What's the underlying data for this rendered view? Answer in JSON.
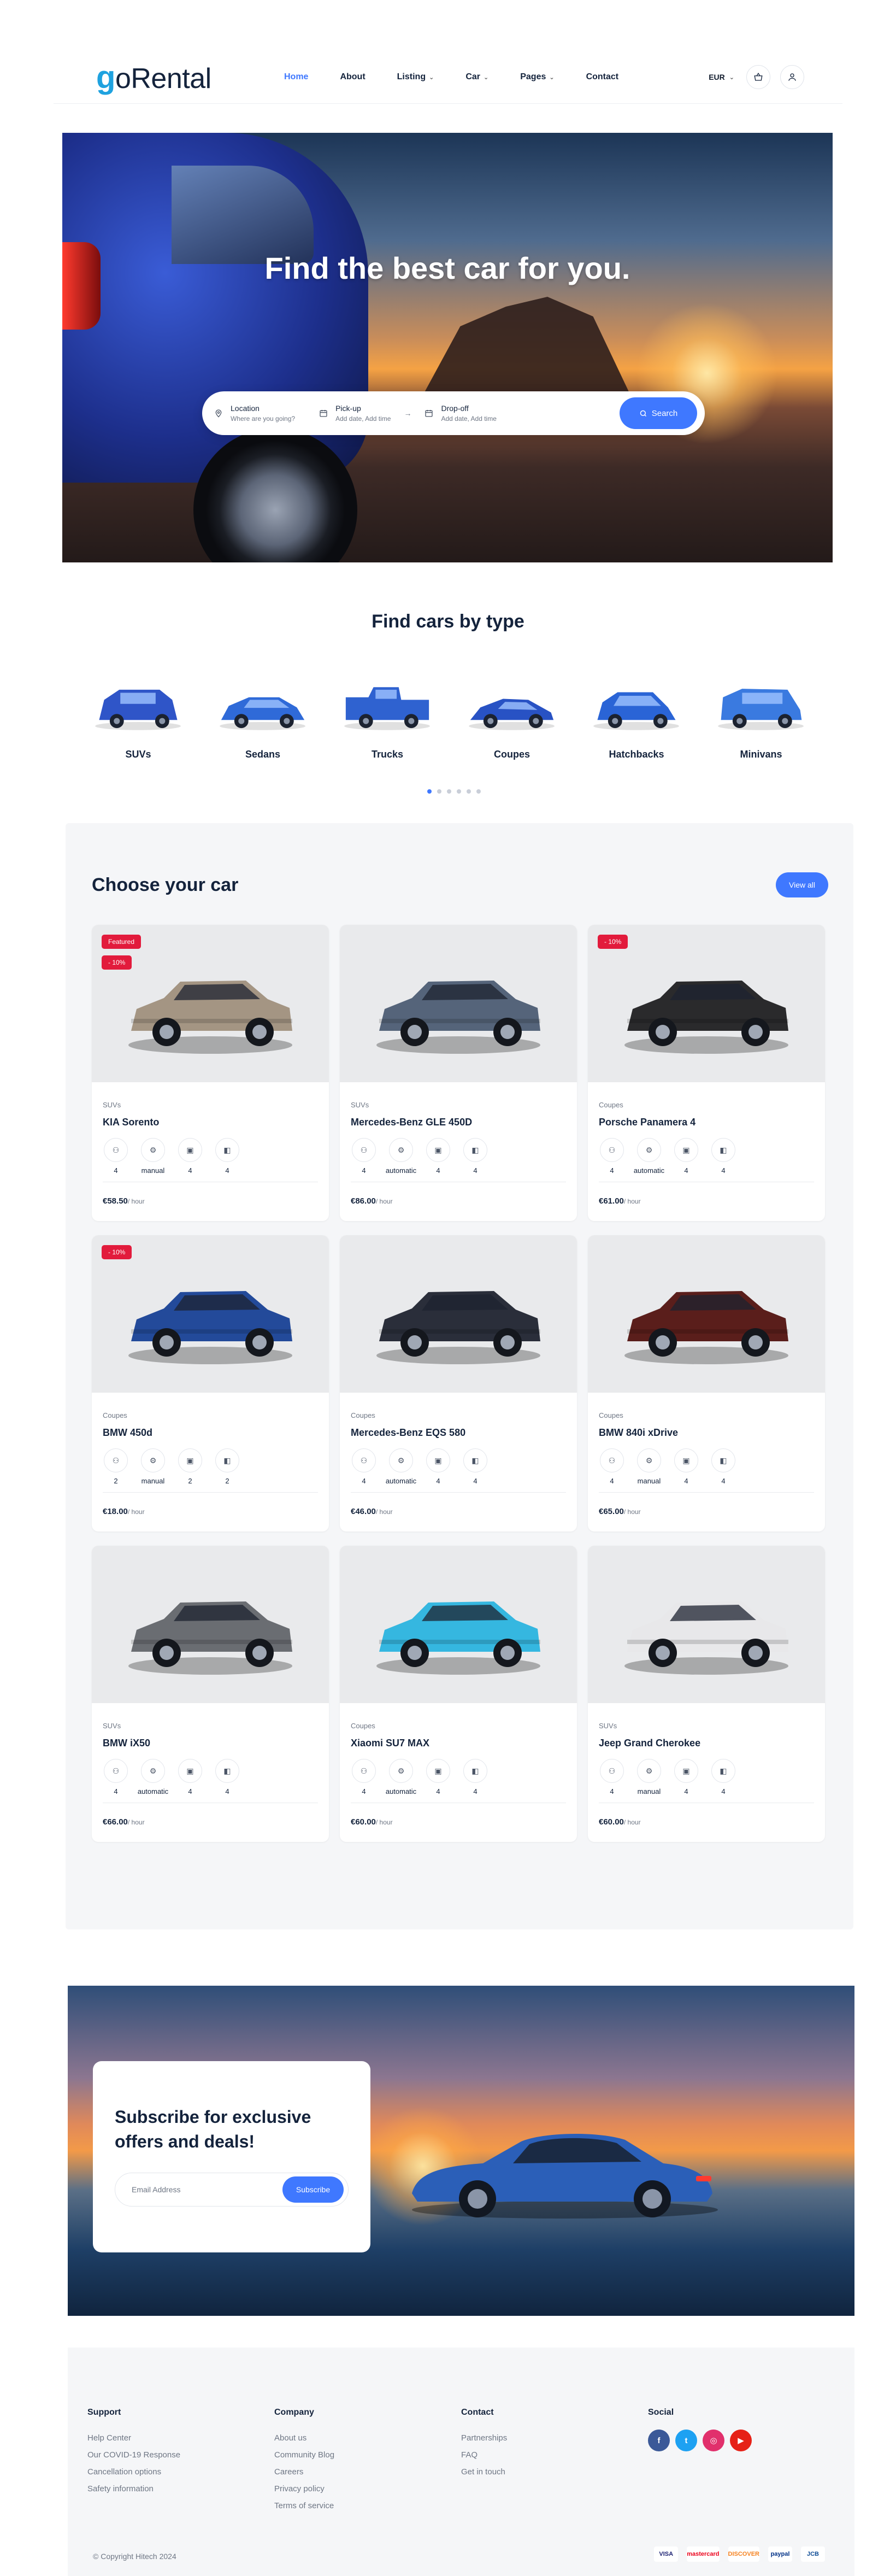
{
  "header": {
    "logo_g": "g",
    "logo_rest": "oRental",
    "nav": [
      {
        "label": "Home",
        "active": true,
        "dropdown": false
      },
      {
        "label": "About",
        "active": false,
        "dropdown": false
      },
      {
        "label": "Listing",
        "active": false,
        "dropdown": true
      },
      {
        "label": "Car",
        "active": false,
        "dropdown": true
      },
      {
        "label": "Pages",
        "active": false,
        "dropdown": true
      },
      {
        "label": "Contact",
        "active": false,
        "dropdown": false
      }
    ],
    "currency": "EUR"
  },
  "hero": {
    "title": "Find the best car for you.",
    "search": {
      "location_label": "Location",
      "location_placeholder": "Where are you going?",
      "pickup_label": "Pick-up",
      "pickup_placeholder": "Add date, Add time",
      "dropoff_label": "Drop-off",
      "dropoff_placeholder": "Add date, Add time",
      "button": "Search"
    }
  },
  "types": {
    "title": "Find cars by type",
    "items": [
      "SUVs",
      "Sedans",
      "Trucks",
      "Coupes",
      "Hatchbacks",
      "Minivans"
    ],
    "pagination": {
      "total": 6,
      "active": 0
    }
  },
  "listing": {
    "title": "Choose your car",
    "view_all": "View all",
    "per_unit": "/ hour",
    "cars": [
      {
        "category": "SUVs",
        "name": "KIA Sorento",
        "badges": [
          "Featured",
          "- 10%"
        ],
        "seats": "4",
        "transmission": "manual",
        "bags": "4",
        "doors": "4",
        "price": "€58.50",
        "color": "#a49583"
      },
      {
        "category": "SUVs",
        "name": "Mercedes-Benz GLE 450D",
        "badges": [],
        "seats": "4",
        "transmission": "automatic",
        "bags": "4",
        "doors": "4",
        "price": "€86.00",
        "color": "#55647a"
      },
      {
        "category": "Coupes",
        "name": "Porsche Panamera 4",
        "badges": [
          "- 10%"
        ],
        "seats": "4",
        "transmission": "automatic",
        "bags": "4",
        "doors": "4",
        "price": "€61.00",
        "color": "#2a2a2c"
      },
      {
        "category": "Coupes",
        "name": "BMW 450d",
        "badges": [
          "- 10%"
        ],
        "seats": "2",
        "transmission": "manual",
        "bags": "2",
        "doors": "2",
        "price": "€18.00",
        "color": "#234a9a"
      },
      {
        "category": "Coupes",
        "name": "Mercedes-Benz EQS 580",
        "badges": [],
        "seats": "4",
        "transmission": "automatic",
        "bags": "4",
        "doors": "4",
        "price": "€46.00",
        "color": "#2a2e3a"
      },
      {
        "category": "Coupes",
        "name": "BMW 840i xDrive",
        "badges": [],
        "seats": "4",
        "transmission": "manual",
        "bags": "4",
        "doors": "4",
        "price": "€65.00",
        "color": "#5a1e1b"
      },
      {
        "category": "SUVs",
        "name": "BMW iX50",
        "badges": [],
        "seats": "4",
        "transmission": "automatic",
        "bags": "4",
        "doors": "4",
        "price": "€66.00",
        "color": "#6a6d72"
      },
      {
        "category": "Coupes",
        "name": "Xiaomi SU7 MAX",
        "badges": [],
        "seats": "4",
        "transmission": "automatic",
        "bags": "4",
        "doors": "4",
        "price": "€60.00",
        "color": "#35b7e0"
      },
      {
        "category": "SUVs",
        "name": "Jeep Grand Cherokee",
        "badges": [],
        "seats": "4",
        "transmission": "manual",
        "bags": "4",
        "doors": "4",
        "price": "€60.00",
        "color": "#e8e8ea"
      }
    ]
  },
  "subscribe": {
    "title": "Subscribe for exclusive offers and deals!",
    "placeholder": "Email Address",
    "button": "Subscribe"
  },
  "footer": {
    "support": {
      "title": "Support",
      "links": [
        "Help Center",
        "Our COVID-19 Response",
        "Cancellation options",
        "Safety information"
      ]
    },
    "company": {
      "title": "Company",
      "links": [
        "About us",
        "Community Blog",
        "Careers",
        "Privacy policy",
        "Terms of service"
      ]
    },
    "contact": {
      "title": "Contact",
      "links": [
        "Partnerships",
        "FAQ",
        "Get in touch"
      ]
    },
    "social": {
      "title": "Social",
      "items": [
        {
          "name": "facebook-icon",
          "glyph": "f",
          "color": "#3b5998"
        },
        {
          "name": "twitter-icon",
          "glyph": "t",
          "color": "#1da1f2"
        },
        {
          "name": "instagram-icon",
          "glyph": "◎",
          "color": "#e1306c"
        },
        {
          "name": "youtube-icon",
          "glyph": "▶",
          "color": "#e62117"
        }
      ]
    },
    "copyright": "© Copyright Hitech 2024",
    "payments": [
      "VISA",
      "mastercard",
      "DISCOVER",
      "paypal",
      "JCB"
    ]
  }
}
